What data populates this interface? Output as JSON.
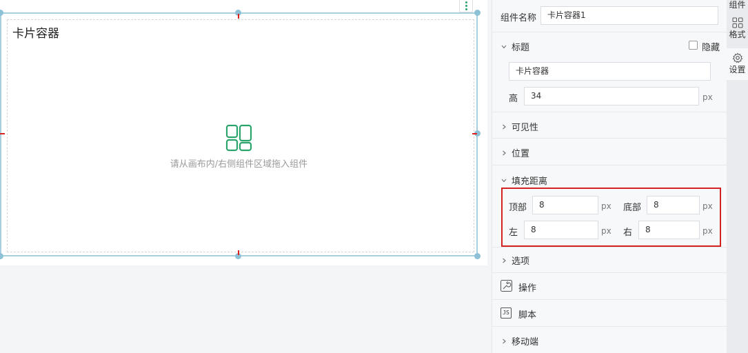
{
  "canvas": {
    "card_title": "卡片容器",
    "empty_hint": "请从画布内/右侧组件区域拖入组件"
  },
  "panel": {
    "component_name_label": "组件名称",
    "component_name_value": "卡片容器1",
    "title_section": {
      "label": "标题",
      "hide_label": "隐藏",
      "title_value": "卡片容器",
      "height_label": "高",
      "height_value": "34",
      "height_unit": "px"
    },
    "visibility_label": "可见性",
    "position_label": "位置",
    "padding_section": {
      "label": "填充距离",
      "top_label": "顶部",
      "top_value": "8",
      "bottom_label": "底部",
      "bottom_value": "8",
      "left_label": "左",
      "left_value": "8",
      "right_label": "右",
      "right_value": "8",
      "unit": "px"
    },
    "options_label": "选项",
    "actions_label": "操作",
    "script_label": "脚本",
    "script_icon_text": "JS",
    "mobile_label": "移动端"
  },
  "rail": {
    "components_label": "组件",
    "format_label": "格式",
    "settings_label": "设置"
  },
  "colors": {
    "accent_green": "#2ba46b",
    "highlight_red": "#d42020",
    "selection_blue": "#8cc1d6"
  }
}
